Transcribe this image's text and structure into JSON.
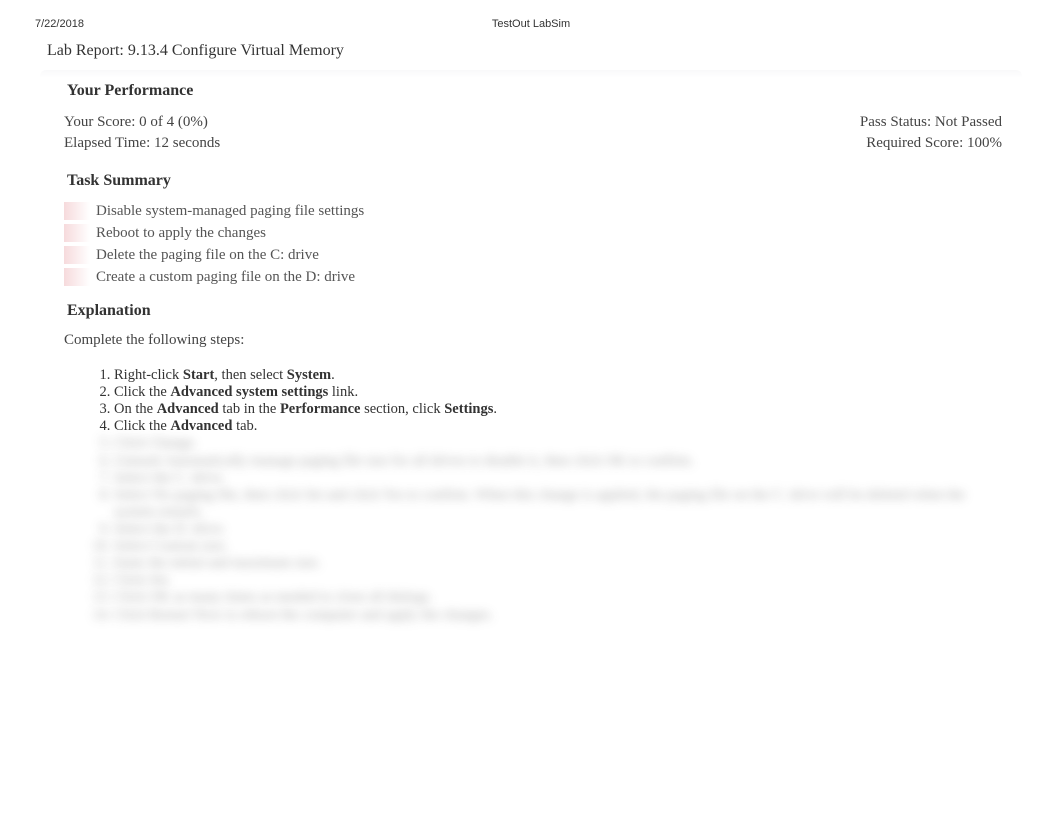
{
  "header": {
    "date": "7/22/2018",
    "product": "TestOut LabSim"
  },
  "labTitle": "Lab Report: 9.13.4 Configure Virtual Memory",
  "performance": {
    "heading": "Your Performance",
    "scoreLabel": "Your Score: 0 of 4 (0%)",
    "passStatus": "Pass Status: Not Passed",
    "elapsedTime": "Elapsed Time: 12 seconds",
    "requiredScore": "Required Score: 100%"
  },
  "taskSummary": {
    "heading": "Task Summary",
    "items": [
      "Disable system-managed paging file settings",
      "Reboot to apply the changes",
      "Delete the paging file on the C: drive",
      "Create a custom paging file on the D: drive"
    ]
  },
  "explanation": {
    "heading": "Explanation",
    "intro": "Complete the following steps:",
    "steps": [
      {
        "parts": [
          {
            "t": "Right-click "
          },
          {
            "b": "Start"
          },
          {
            "t": ", then select "
          },
          {
            "b": "System"
          },
          {
            "t": "."
          }
        ]
      },
      {
        "parts": [
          {
            "t": "Click the "
          },
          {
            "b": "Advanced system settings"
          },
          {
            "t": " link."
          }
        ]
      },
      {
        "parts": [
          {
            "t": "On the "
          },
          {
            "b": "Advanced"
          },
          {
            "t": " tab in the "
          },
          {
            "b": "Performance"
          },
          {
            "t": " section, click "
          },
          {
            "b": "Settings"
          },
          {
            "t": "."
          }
        ]
      },
      {
        "parts": [
          {
            "t": "Click the "
          },
          {
            "b": "Advanced"
          },
          {
            "t": " tab."
          }
        ]
      }
    ],
    "blurredSteps": [
      "Click Change.",
      "Unmark Automatically manage paging file size for all drives to disable it, then click OK to confirm.",
      "Select the C: drive.",
      "Select No paging file, then click Set and click Yes to confirm. When this change is applied, the paging file on the C: drive will be deleted when the system restarts.",
      "Select the D: drive.",
      "Select Custom size.",
      "Enter the initial and maximum size.",
      "Click Set.",
      "Click OK as many times as needed to close all dialogs.",
      "Click Restart Now to reboot the computer and apply the changes."
    ]
  }
}
